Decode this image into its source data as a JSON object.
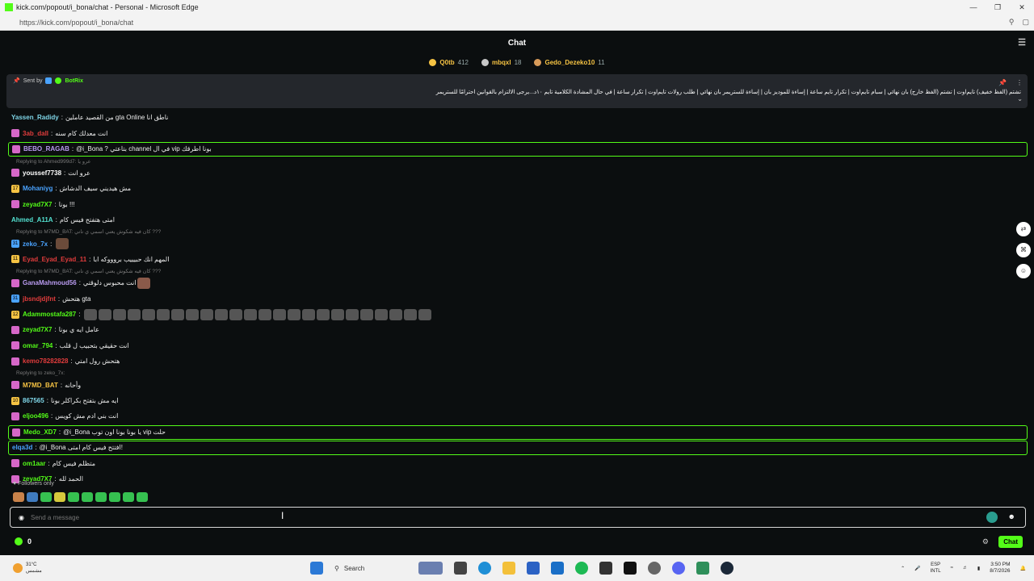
{
  "browser": {
    "window_title": "kick.com/popout/i_bona/chat - Personal - Microsoft Edge",
    "url": "https://kick.com/popout/i_bona/chat"
  },
  "header": {
    "title": "Chat"
  },
  "leaderboard": [
    {
      "name": "Q0tb",
      "count": "412",
      "badge_color": "#f6c343"
    },
    {
      "name": "mbqxl",
      "count": "18",
      "badge_color": "#c8c8c8"
    },
    {
      "name": "Gedo_Dezeko10",
      "count": "11",
      "badge_color": "#d89b5a"
    }
  ],
  "pinned": {
    "sent_by_label": "Sent by",
    "bot_name": "BotRix",
    "message": "تشتم (الفظ خفيف) تايم‌اوت | تشتم (الفظ خارج) بان نهائي | سبام تايم‌اوت | تكرار تايم ساعة | إساءة للموديز بان | إساءة للستريمر بان نهائي | طلب رولات تايم‌اوت | تكرار ساعة | في حال المشادة الكلامية تايم ١٠د...يرجى الالتزام بالقوانين احترامًا للستريمر"
  },
  "messages": [
    {
      "kind": "msg",
      "user": "Yassen_Radidy",
      "user_color": "#7fd6e8",
      "badge": "",
      "badge_color": "",
      "text": "من القصيد عاملين gta Online ناطق انا"
    },
    {
      "kind": "msg",
      "user": "3ab_dall",
      "user_color": "#e03c3c",
      "badge": "",
      "badge_color": "#d667c8",
      "text": "انت معدلك كام سنه"
    },
    {
      "kind": "hl",
      "user": "BEBO_RAGAB",
      "user_color": "#b99bf0",
      "badge": "",
      "badge_color": "#d667c8",
      "text": "@i_Bona ? بتاعتي channel في ال vip بونا اطرقك"
    },
    {
      "kind": "reply",
      "text": "Replying to Ahmed999d7: عرو يا"
    },
    {
      "kind": "msg",
      "user": "youssef7738",
      "user_color": "#ffffff",
      "badge": "",
      "badge_color": "#d667c8",
      "text": "عرو انت"
    },
    {
      "kind": "msg",
      "user": "Mohaniyg",
      "user_color": "#4aa3ff",
      "badge": "17",
      "badge_color": "#f6c343",
      "text": "مش هيديني سيف الدشاش"
    },
    {
      "kind": "msg",
      "user": "zeyad7X7",
      "user_color": "#53fc18",
      "badge": "",
      "badge_color": "#d667c8",
      "text": "بونا !!!"
    },
    {
      "kind": "msg",
      "user": "Ahmed_A11A",
      "user_color": "#53e0d0",
      "badge": "",
      "badge_color": "",
      "text": "امتى هتفتح فيس كام"
    },
    {
      "kind": "reply",
      "text": "Replying to M7MD_BAT: كان فيه شكوش يعني اسمي ي ناني ???"
    },
    {
      "kind": "msg",
      "user": "zeko_7x",
      "user_color": "#4aa3ff",
      "badge": "31",
      "badge_color": "#4aa3ff",
      "text": ""
    },
    {
      "kind": "msg",
      "user": "Eyad_Eyad_Eyad_11",
      "user_color": "#e03c3c",
      "badge": "11",
      "badge_color": "#f6c343",
      "text": "المهم انك حبيييب بروووكه ابا"
    },
    {
      "kind": "reply",
      "text": "Replying to M7MD_BAT: كان فيه شكوش يعني اسمي ي ناني ???"
    },
    {
      "kind": "msg",
      "user": "GanaMahmoud56",
      "user_color": "#b99bf0",
      "badge": "",
      "badge_color": "#d667c8",
      "text": "انت محبوس دلوقتي"
    },
    {
      "kind": "msg",
      "user": "jbsndjdjfnt",
      "user_color": "#e03c3c",
      "badge": "31",
      "badge_color": "#4aa3ff",
      "text": "هتحش gta"
    },
    {
      "kind": "msg",
      "user": "Adammostafa287",
      "user_color": "#53fc18",
      "badge": "12",
      "badge_color": "#f6c343",
      "text": ""
    },
    {
      "kind": "msg",
      "user": "zeyad7X7",
      "user_color": "#53fc18",
      "badge": "",
      "badge_color": "#d667c8",
      "text": "عامل ايه ي بونا"
    },
    {
      "kind": "msg",
      "user": "omar_794",
      "user_color": "#53fc18",
      "badge": "",
      "badge_color": "#d667c8",
      "text": "انت حقيقي بتحبيب ل قلب"
    },
    {
      "kind": "msg",
      "user": "kemo78282828",
      "user_color": "#e03c3c",
      "badge": "",
      "badge_color": "#d667c8",
      "text": "هتحش رول امتي"
    },
    {
      "kind": "reply",
      "text": "Replying to zeko_7x:"
    },
    {
      "kind": "msg",
      "user": "M7MD_BAT",
      "user_color": "#f6c343",
      "badge": "",
      "badge_color": "#d667c8",
      "text": "وأحانه"
    },
    {
      "kind": "msg",
      "user": "867565",
      "user_color": "#7fd6e8",
      "badge": "10",
      "badge_color": "#f6c343",
      "text": "ايه مش بتفتح بكراكلر بونا"
    },
    {
      "kind": "msg",
      "user": "eljoo496",
      "user_color": "#53fc18",
      "badge": "",
      "badge_color": "#d667c8",
      "text": "انت بني ادم مش كويس"
    },
    {
      "kind": "hl",
      "user": "Medo_XD7",
      "user_color": "#53fc18",
      "badge": "",
      "badge_color": "#d667c8",
      "text": "@i_Bona يا بونا بونا اون توب vip حلت"
    },
    {
      "kind": "hl",
      "user": "elqa3d",
      "user_color": "#4aa3ff",
      "badge": "",
      "badge_color": "",
      "text": "@i_Bona افتتح فيس كام امتى!"
    },
    {
      "kind": "msg",
      "user": "om1aar",
      "user_color": "#53fc18",
      "badge": "",
      "badge_color": "#d667c8",
      "text": "متظلم فيس كام"
    },
    {
      "kind": "msg",
      "user": "zeyad7X7",
      "user_color": "#53fc18",
      "badge": "",
      "badge_color": "#d667c8",
      "text": "الحمد لله"
    }
  ],
  "followers_only_label": "Followers only",
  "input": {
    "placeholder": "Send a message"
  },
  "bottom": {
    "points": "0",
    "send_label": "Chat"
  },
  "taskbar": {
    "temp": "31°C",
    "weather_text": "مشمس",
    "search_label": "Search",
    "lang_line1": "ESP",
    "lang_line2": "INTL",
    "time": "3:50 PM",
    "date": "8/7/2026"
  },
  "colors": {
    "accent": "#53fc18",
    "background": "#0b0e0f",
    "pinned_bg": "#24272c"
  }
}
